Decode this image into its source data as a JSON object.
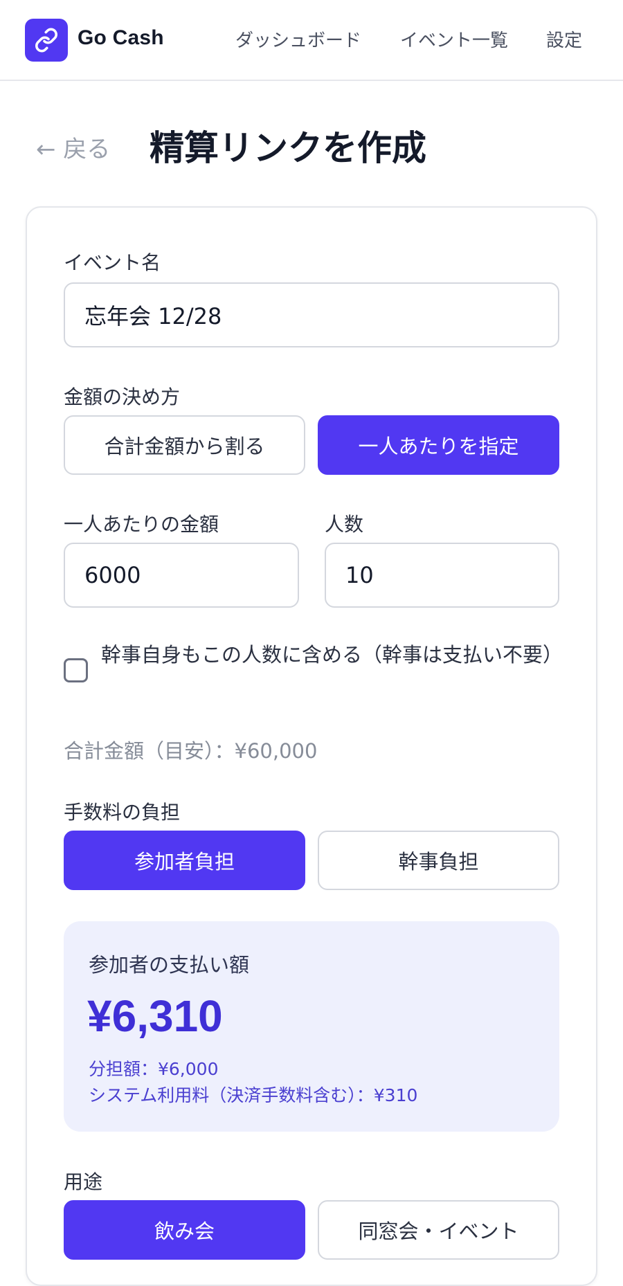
{
  "header": {
    "brand": "Go Cash",
    "nav": {
      "dashboard": "ダッシュボード",
      "events": "イベント一覧",
      "settings": "設定"
    }
  },
  "page": {
    "back_label": "← 戻る",
    "title": "精算リンクを作成"
  },
  "form": {
    "event_name": {
      "label": "イベント名",
      "value": "忘年会 12/28"
    },
    "amount_method": {
      "label": "金額の決め方",
      "options": [
        "合計金額から割る",
        "一人あたりを指定"
      ],
      "selected": "一人あたりを指定"
    },
    "per_person": {
      "label": "一人あたりの金額",
      "value": "6000"
    },
    "headcount": {
      "label": "人数",
      "value": "10"
    },
    "include_organizer": {
      "label": "幹事自身もこの人数に含める（幹事は支払い不要）",
      "checked": false
    },
    "total_hint": "合計金額（目安）：¥60,000",
    "fee_bearer": {
      "label": "手数料の負担",
      "options": [
        "参加者負担",
        "幹事負担"
      ],
      "selected": "参加者負担"
    },
    "payment_summary": {
      "label": "参加者の支払い額",
      "amount": "¥6,310",
      "share": "分担額：¥6,000",
      "fee": "システム利用料（決済手数料含む）：¥310"
    },
    "purpose": {
      "label": "用途",
      "options": [
        "飲み会",
        "同窓会・イベント"
      ],
      "selected": "飲み会"
    }
  },
  "colors": {
    "accent": "#5138f2",
    "summary_bg": "#eef0fd",
    "summary_amount": "#3f2fd6"
  }
}
